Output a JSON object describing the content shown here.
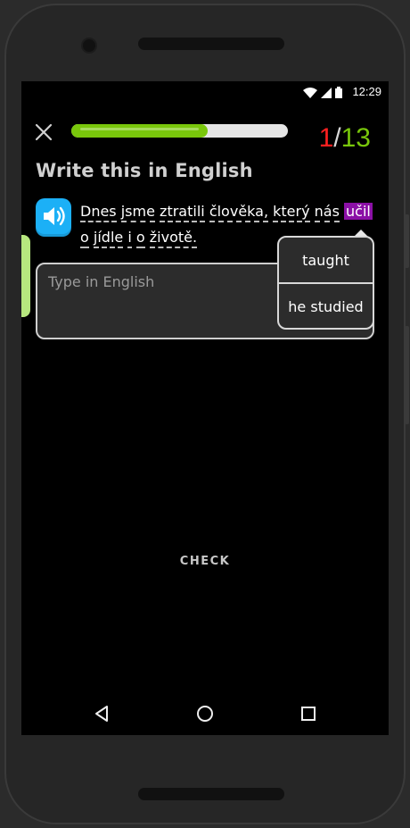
{
  "status": {
    "time": "12:29",
    "icons": [
      "wifi-icon",
      "signal-icon",
      "battery-icon"
    ]
  },
  "header": {
    "progress": 0.63,
    "counter_current": "1",
    "counter_sep": "/",
    "counter_total": "13",
    "colors": {
      "current": "#ff2020",
      "sep": "#d8d8d8",
      "total": "#79c70b",
      "progress": "#79c70b"
    }
  },
  "prompt": {
    "title": "Write this in English"
  },
  "sentence": {
    "line1": [
      "Dnes",
      "jsme",
      "ztratili",
      "člověka,",
      "který",
      "nás"
    ],
    "highlight": "učil",
    "line2": [
      "o",
      "jídle",
      "i",
      "o",
      "životě."
    ]
  },
  "hint": {
    "options": [
      "taught",
      "he studied"
    ]
  },
  "answer": {
    "placeholder": "Type in English",
    "value": ""
  },
  "footer": {
    "check_label": "CHECK"
  },
  "nav": {
    "icons": [
      "back-icon",
      "home-icon",
      "recents-icon"
    ]
  }
}
